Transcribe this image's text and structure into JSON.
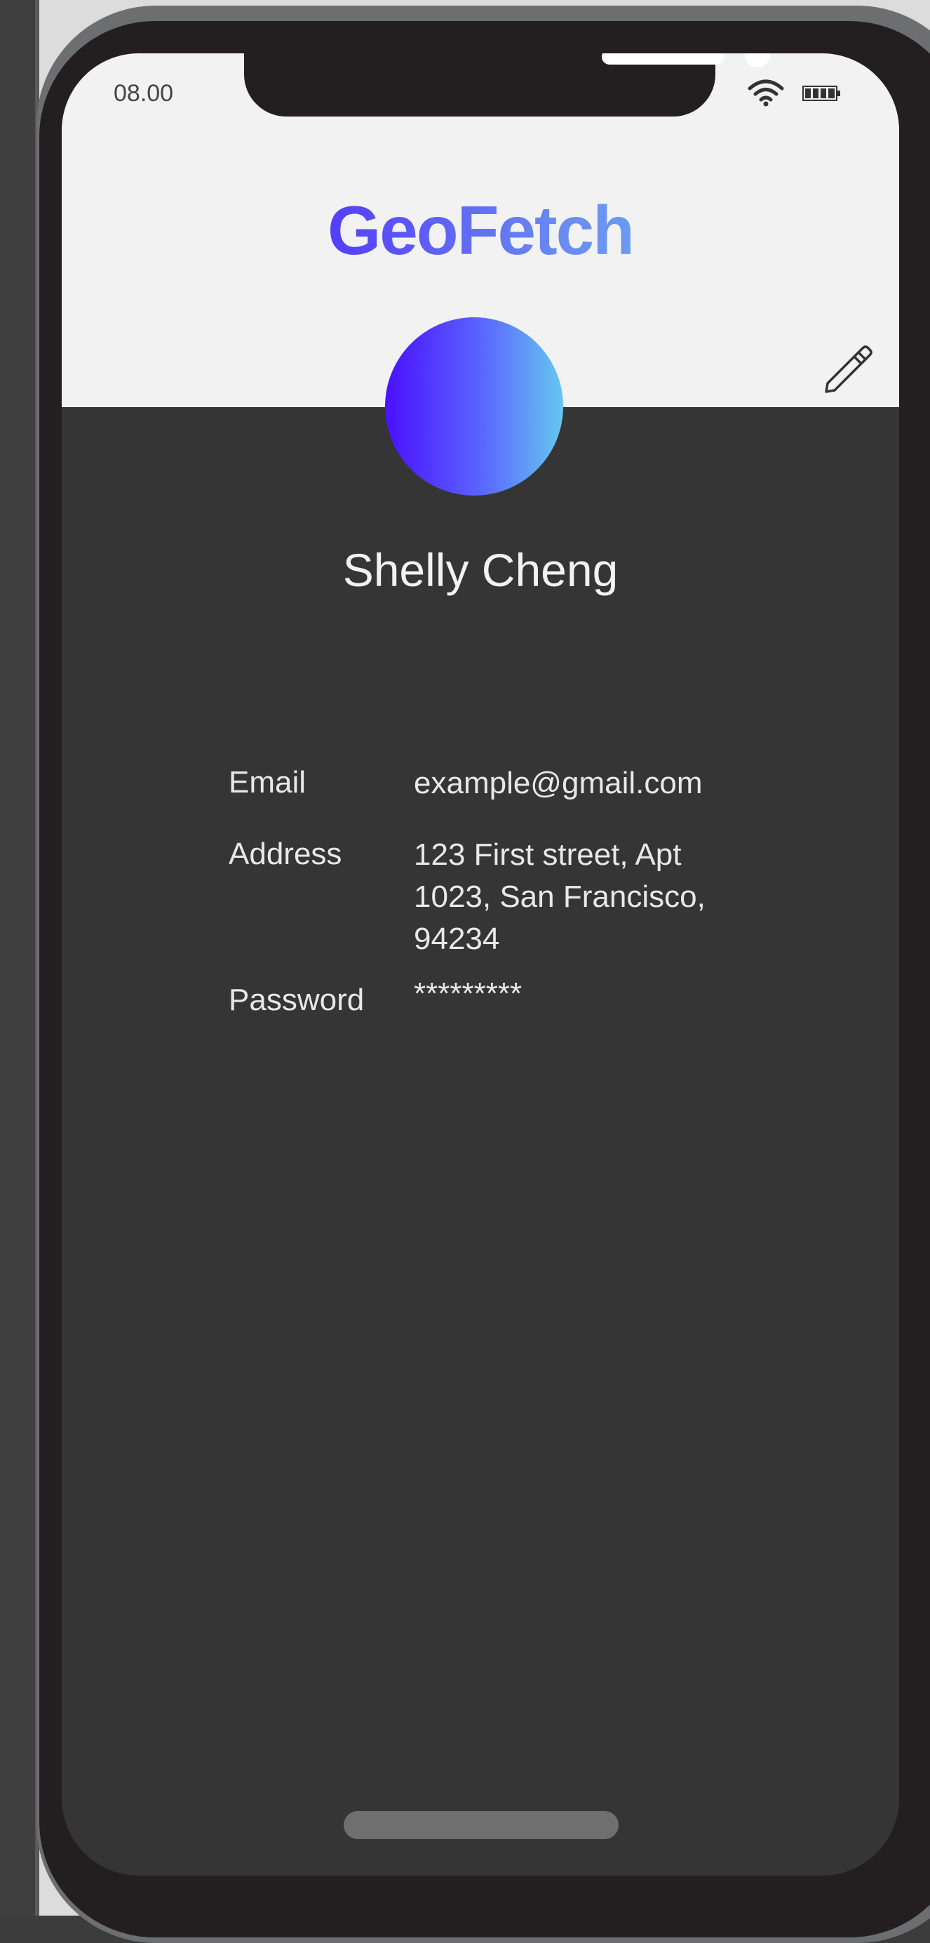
{
  "status_bar": {
    "time": "08.00",
    "icons": [
      "wifi-icon",
      "battery-icon"
    ]
  },
  "header": {
    "app_title": "GeoFetch",
    "edit_icon": "pencil-icon",
    "title_gradient": [
      "#4b1cff",
      "#6ed2f2"
    ]
  },
  "profile": {
    "name": "Shelly Cheng",
    "avatar_gradient": [
      "#4a10ff",
      "#65c8f0"
    ],
    "fields": [
      {
        "label": "Email",
        "value": "example@gmail.com"
      },
      {
        "label": "Address",
        "value_lines": [
          "123 First street, Apt",
          "1023, San Francisco,",
          "94234"
        ]
      },
      {
        "label": "Password",
        "value": "*********"
      }
    ]
  },
  "colors": {
    "header_bg": "#f2f2f2",
    "screen_bg": "#353535",
    "frame": "#231f20"
  }
}
